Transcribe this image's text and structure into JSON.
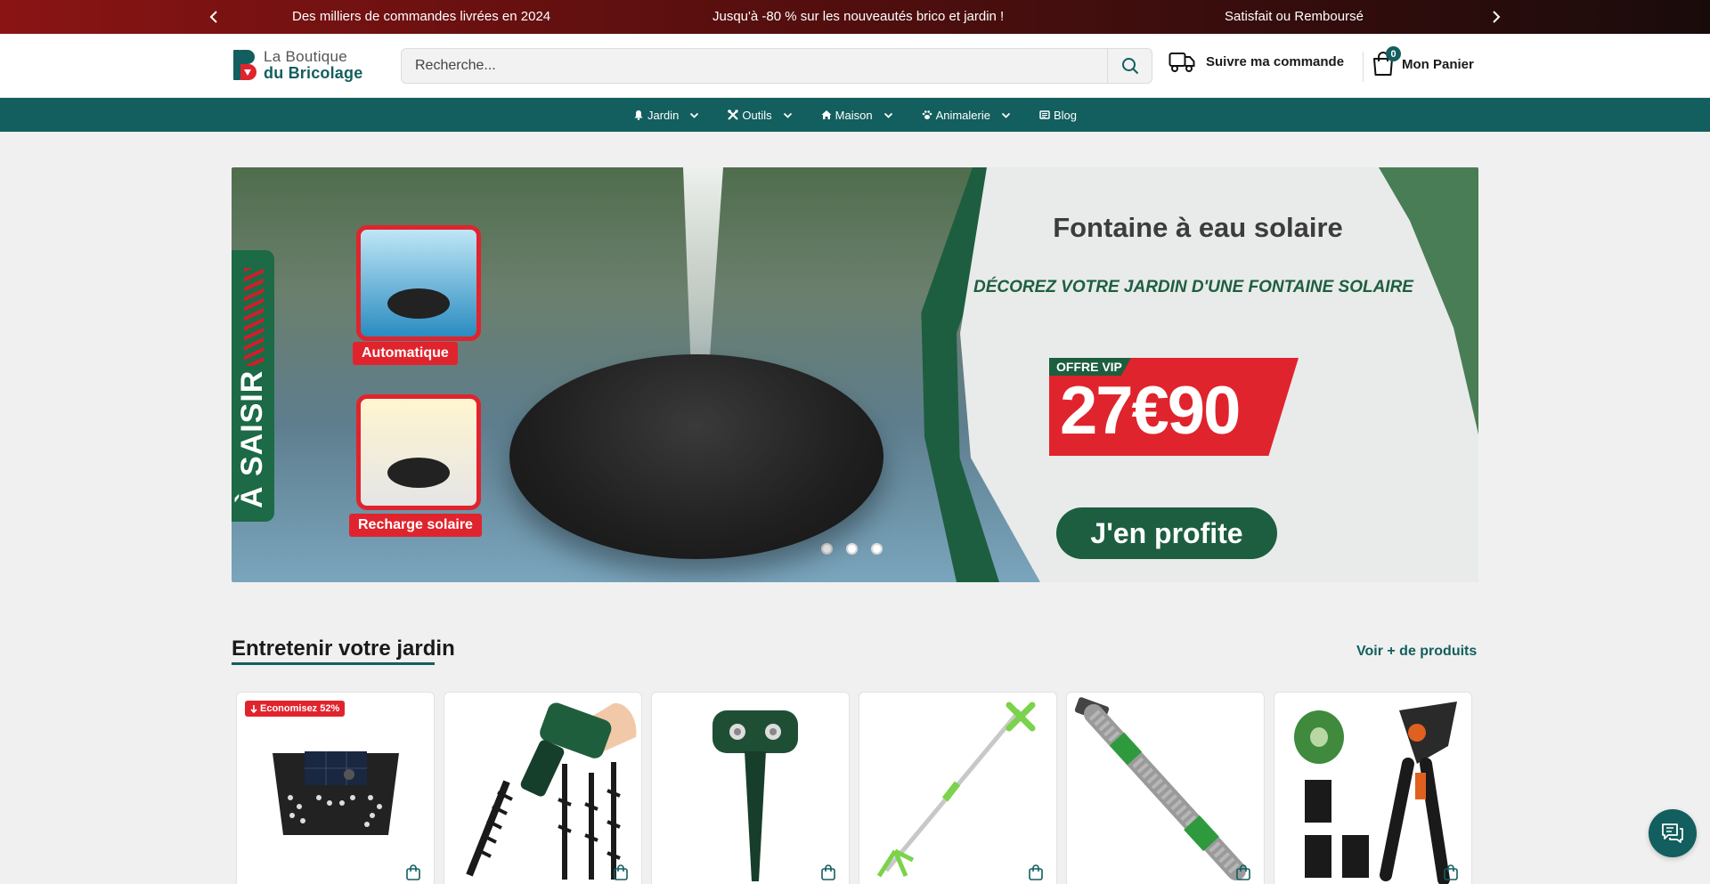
{
  "announcement": {
    "messages": [
      "Des milliers de commandes livrées en 2024",
      "Jusqu'à -80 % sur les nouveautés brico et jardin !",
      "Satisfait ou Remboursé"
    ]
  },
  "header": {
    "logo_line1": "La Boutique",
    "logo_line2": "du Bricolage",
    "search_placeholder": "Recherche...",
    "track_label": "Suivre ma commande",
    "cart_label": "Mon Panier",
    "cart_count": "0"
  },
  "nav": {
    "items": [
      {
        "label": "Jardin",
        "icon": "bell-icon"
      },
      {
        "label": "Outils",
        "icon": "tools-icon"
      },
      {
        "label": "Maison",
        "icon": "home-icon"
      },
      {
        "label": "Animalerie",
        "icon": "paw-icon"
      },
      {
        "label": "Blog",
        "icon": "newspaper-icon"
      }
    ]
  },
  "hero": {
    "side_label": "À SAISIR",
    "feature1": "Automatique",
    "feature2": "Recharge solaire",
    "title": "Fontaine à eau solaire",
    "subtitle": "DÉCOREZ VOTRE JARDIN D'UNE FONTAINE SOLAIRE",
    "offer_label": "OFFRE VIP",
    "price": "27€90",
    "cta": "J'en profite",
    "slide_count": 3,
    "active_slide": 1
  },
  "section": {
    "title": "Entretenir votre jardin",
    "link": "Voir + de produits"
  },
  "products": [
    {
      "badge": "Economisez 52%",
      "name": "solar-wall-light"
    },
    {
      "badge": "",
      "name": "drill-auger-set"
    },
    {
      "badge": "",
      "name": "ultrasonic-repeller"
    },
    {
      "badge": "",
      "name": "weed-puller"
    },
    {
      "badge": "",
      "name": "telescopic-hose-wand"
    },
    {
      "badge": "",
      "name": "grafting-pruner-kit"
    }
  ],
  "colors": {
    "brand_teal": "#135e5e",
    "sale_red": "#e0242d",
    "banner_green": "#1d5e40"
  }
}
